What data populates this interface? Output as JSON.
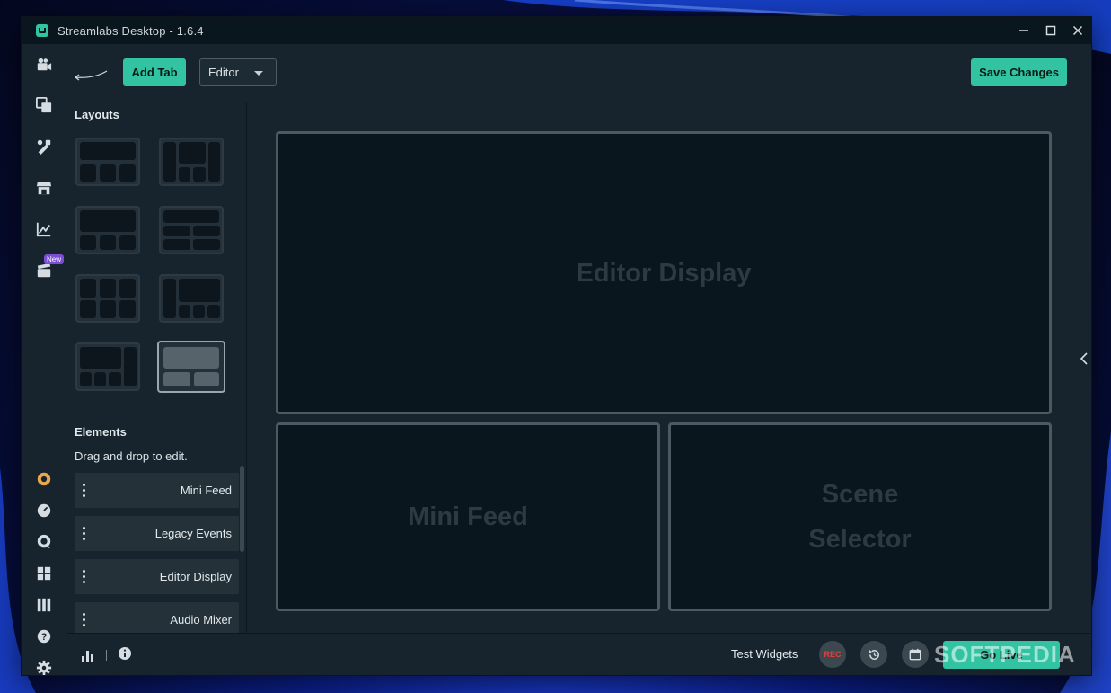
{
  "window": {
    "title": "Streamlabs Desktop - 1.6.4"
  },
  "toolbar": {
    "add_tab_label": "Add Tab",
    "editor_select_value": "Editor",
    "save_changes_label": "Save Changes"
  },
  "nav": {
    "items": [
      {
        "name": "editor-icon"
      },
      {
        "name": "themes-icon"
      },
      {
        "name": "app-store-icon"
      },
      {
        "name": "store-icon"
      },
      {
        "name": "dashboard-icon"
      },
      {
        "name": "highlighter-icon"
      }
    ],
    "new_badge": "New",
    "bottom_items": [
      {
        "name": "ultra-icon"
      },
      {
        "name": "dashboard-link-icon"
      },
      {
        "name": "chat-icon"
      },
      {
        "name": "layout-editor-icon"
      },
      {
        "name": "studio-mode-icon"
      },
      {
        "name": "help-icon"
      },
      {
        "name": "settings-icon"
      }
    ]
  },
  "layouts": {
    "title": "Layouts",
    "selected_index": 7
  },
  "elements": {
    "title": "Elements",
    "hint": "Drag and drop to edit.",
    "items": [
      "Mini Feed",
      "Legacy Events",
      "Editor Display",
      "Audio Mixer"
    ]
  },
  "canvas": {
    "slot_top": "Editor Display",
    "slot_bottom_left": "Mini Feed",
    "slot_bottom_right_line1": "Scene",
    "slot_bottom_right_line2": "Selector"
  },
  "footer": {
    "test_widgets_label": "Test Widgets",
    "rec_label": "REC",
    "go_live_label": "Go Live"
  },
  "watermark": "SOFTPEDIA",
  "colors": {
    "accent": "#31c3a2",
    "panel": "#17242d",
    "dark": "#09161d",
    "new_badge": "#7c4dd6",
    "rec": "#e0413b"
  }
}
